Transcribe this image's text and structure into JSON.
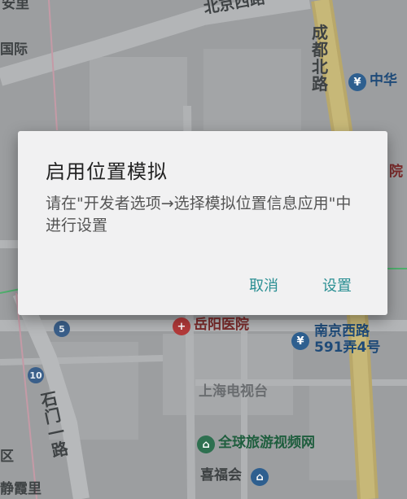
{
  "map": {
    "labels": {
      "anli": "安里",
      "beijing_west_road": "北京西路",
      "guoji": "国际",
      "chengdu_north_road": "成都北路",
      "zhonghua": "中华",
      "yue": "院",
      "yueyang_hospital": "岳阳医院",
      "nanjing_west_road": "南京西路",
      "alley_591": "591弄4号",
      "shanghai_tv": "上海电视台",
      "shimen_first_road": "石门一路",
      "global_travel": "全球旅游视频网",
      "xifu_hui": "喜福会",
      "qu": "区",
      "jingxiali": "静霞里"
    },
    "road_numbers": {
      "r5": "5",
      "r10": "10"
    },
    "colors": {
      "background": "#9c9ea0",
      "road": "#b0b2b4",
      "highway": "#b9a86a"
    }
  },
  "dialog": {
    "title": "启用位置模拟",
    "message": "请在\"开发者选项→选择模拟位置信息应用\"中进行设置",
    "cancel_label": "取消",
    "settings_label": "设置",
    "accent_color": "#2a8f93"
  }
}
